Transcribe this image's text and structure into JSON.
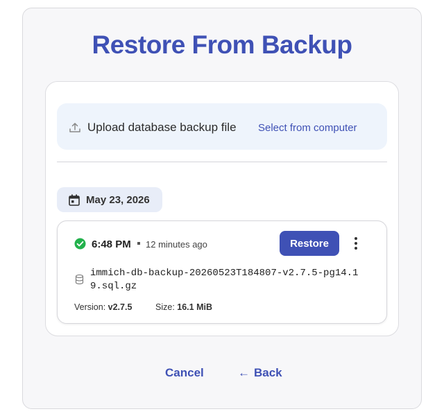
{
  "title": "Restore From Backup",
  "upload": {
    "label": "Upload database backup file",
    "select_link": "Select from computer",
    "icon": "upload-icon"
  },
  "date_group": {
    "label": "May 23, 2026",
    "icon": "calendar-icon"
  },
  "backup": {
    "time": "6:48 PM",
    "relative_time": "12 minutes ago",
    "restore_label": "Restore",
    "filename": "immich-db-backup-20260523T184807-v2.7.5-pg14.19.sql.gz",
    "version_label": "Version:",
    "version_value": "v2.7.5",
    "size_label": "Size:",
    "size_value": "16.1 MiB",
    "status_icon": "check-circle-icon",
    "file_icon": "database-icon",
    "menu_icon": "more-vertical-icon"
  },
  "footer": {
    "cancel_label": "Cancel",
    "back_label": "Back",
    "back_icon": "arrow-left-icon"
  },
  "colors": {
    "accent": "#3f51b5",
    "success": "#22b14c",
    "upload_bg": "#eef4fc",
    "chip_bg": "#e8edf8"
  }
}
